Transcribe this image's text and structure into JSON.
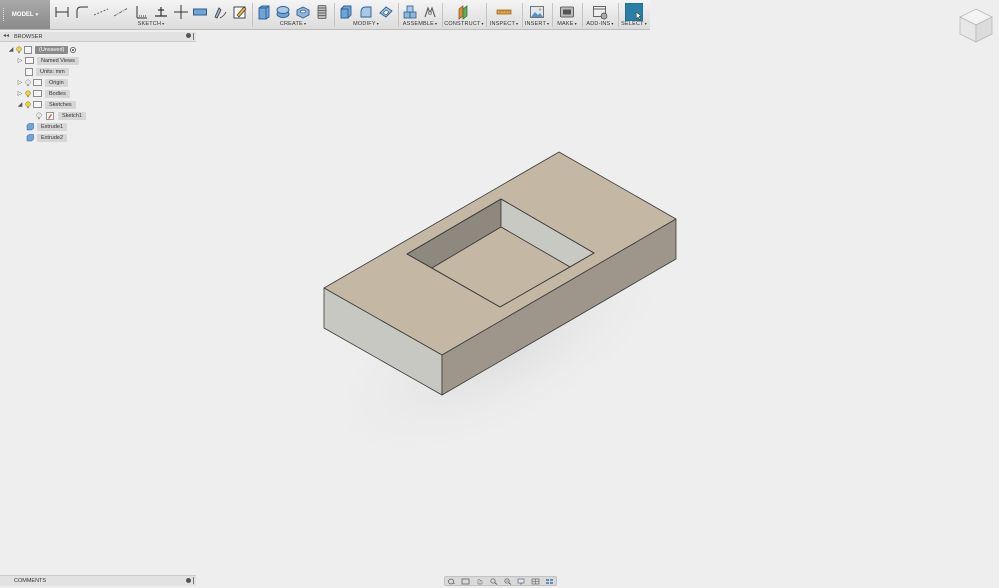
{
  "workspace": {
    "label": "MODEL",
    "caret": "▾"
  },
  "toolbar": {
    "groups": [
      {
        "label": "SKETCH",
        "icons": [
          "line-icon",
          "arc-icon",
          "construction-line-icon",
          "centerline-icon",
          "dimension-icon",
          "trim-icon",
          "point-icon",
          "rectangle-icon",
          "sketch-text-icon",
          "finish-sketch-icon"
        ]
      },
      {
        "label": "CREATE",
        "icons": [
          "extrude-icon",
          "revolve-icon",
          "hole-icon",
          "thread-icon"
        ]
      },
      {
        "label": "MODIFY",
        "icons": [
          "press-pull-icon",
          "fillet-icon",
          "shell-icon"
        ]
      },
      {
        "label": "ASSEMBLE",
        "icons": [
          "new-component-icon",
          "joint-icon"
        ]
      },
      {
        "label": "CONSTRUCT",
        "icons": [
          "offset-plane-icon"
        ]
      },
      {
        "label": "INSPECT",
        "icons": [
          "measure-icon"
        ]
      },
      {
        "label": "INSERT",
        "icons": [
          "insert-image-icon"
        ]
      },
      {
        "label": "MAKE",
        "icons": [
          "3d-print-icon"
        ]
      },
      {
        "label": "ADD-INS",
        "icons": [
          "scripts-addins-icon"
        ]
      },
      {
        "label": "SELECT",
        "icons": [
          "select-icon"
        ]
      }
    ]
  },
  "browser": {
    "title": "BROWSER",
    "root": "(Unsaved)",
    "items": [
      "Named Views",
      "Units: mm",
      "Origin",
      "Bodies",
      "Sketches"
    ],
    "sketches": [
      "Sketch1"
    ],
    "features": [
      "Extrude1",
      "Extrude2"
    ]
  },
  "comments": {
    "title": "COMMENTS"
  },
  "colors": {
    "accent": "#1e88c7",
    "select_active": "#2a7fa6",
    "body_top": "#c4b8a5",
    "body_side": "#9e968b"
  }
}
